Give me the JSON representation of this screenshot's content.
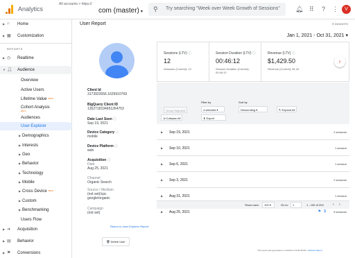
{
  "topbar": {
    "app_title": "Analytics",
    "breadcrumb": "All accounts > https://",
    "property": "com (master)",
    "search_placeholder": "Try searching \"Week over Week Growth of Sessions\"",
    "avatar_letter": "V"
  },
  "sidebar": {
    "home": "Home",
    "customization": "Customization",
    "reports_label": "REPORTS",
    "realtime": "Realtime",
    "audience": "Audience",
    "audience_items": [
      {
        "label": "Overview"
      },
      {
        "label": "Active Users"
      },
      {
        "label": "Lifetime Value",
        "beta": "BETA"
      },
      {
        "label": "Cohort Analysis",
        "beta": "BETA"
      },
      {
        "label": "Audiences"
      },
      {
        "label": "User Explorer"
      }
    ],
    "sub_items": [
      "Demographics",
      "Interests",
      "Geo",
      "Behavior",
      "Technology",
      "Mobile",
      "Cross Device",
      "Custom",
      "Benchmarking"
    ],
    "cross_device_beta": "BETA",
    "users_flow": "Users Flow",
    "acquisition": "Acquisition",
    "behavior": "Behavior",
    "conversions": "Conversions"
  },
  "main": {
    "title": "User Report",
    "insights": "INSIGHTS",
    "date_range": "Jan 1, 2021 - Oct 31, 2021"
  },
  "profile": {
    "client_id_label": "Client Id",
    "client_id": "3173923556.1629910769",
    "bq_label": "BigQuery Client ID",
    "bq_id": "1352718194651264753",
    "last_seen_label": "Date Last Seen",
    "last_seen": "Sep 19, 2021",
    "device_cat_label": "Device Category",
    "device_cat": "mobile",
    "device_plat_label": "Device Platform",
    "device_plat": "web",
    "acquisition_label": "Acquisition",
    "acq_date_label": "Date",
    "acq_date": "Aug 25, 2021",
    "channel_label": "Channel",
    "channel": "Organic Search",
    "source_label": "Source / Medium",
    "source_1": "(not set)/cpc",
    "source_2": "google/organic",
    "campaign_label": "Campaign",
    "campaign": "(not set)",
    "return_link": "Return to User Explorer Report",
    "delete_button": "Delete User"
  },
  "metrics": [
    {
      "title": "Sessions (LTV)",
      "value": "12",
      "sub": "Sessions (Current): 12"
    },
    {
      "title": "Session Duration (LTV)",
      "value": "00:46:12",
      "sub": "Session Duration (Current): 00:46:12"
    },
    {
      "title": "Revenue (LTV)",
      "value": "$1,429.50",
      "sub": "Revenue (Current): $1,42"
    }
  ],
  "controls": {
    "filter_label": "Filter by",
    "sort_label": "Sort by",
    "filter_value": "4 selected",
    "sort_value": "Descending",
    "expand_all": "Expand All",
    "collapse_all": "Collapse All",
    "export": "Export",
    "group_segment": "Group Segment"
  },
  "rows": [
    {
      "date": "Sep 19, 2021",
      "sessions": "2 sessions"
    },
    {
      "date": "Sep 10, 2021",
      "sessions": "1 session"
    },
    {
      "date": "Sep 6, 2021",
      "sessions": "1 session"
    },
    {
      "date": "Sep 3, 2021",
      "sessions": "2 sessions"
    },
    {
      "date": "Aug 31, 2021",
      "sessions": "1 session"
    },
    {
      "date": "Aug 25, 2021",
      "sessions": "5 sessions"
    }
  ],
  "pager": {
    "show_rows": "Show rows:",
    "rows_value": "100",
    "go_to": "Go to:",
    "go_value": "1",
    "range": "1 - 100 of 204"
  },
  "footer": {
    "note": "This report was generated on 11/10/21 at 9:05:38 AM - ",
    "refresh": "Refresh Report"
  }
}
